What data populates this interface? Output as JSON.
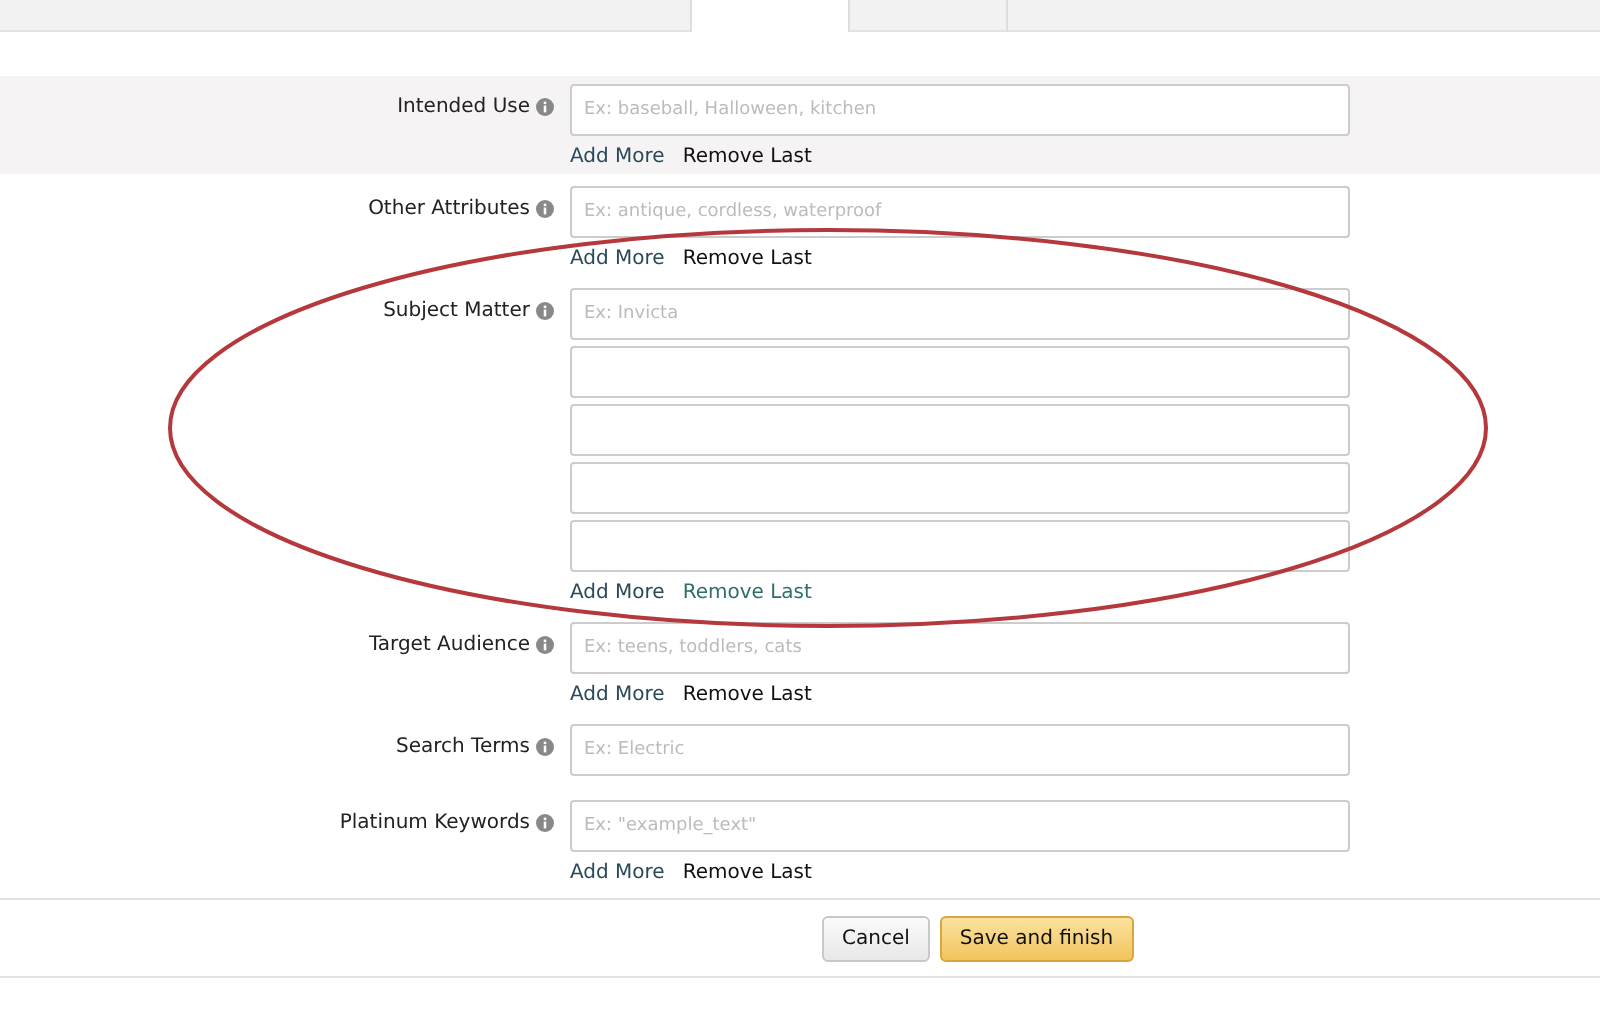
{
  "tabs": [
    {
      "selected": false
    },
    {
      "selected": true
    },
    {
      "selected": false
    }
  ],
  "fields": [
    {
      "label": "Intended Use",
      "highlighted": true,
      "inputs": [
        {
          "placeholder": "Ex: baseball, Halloween, kitchen"
        }
      ],
      "links": {
        "add": "Add More",
        "remove": "Remove Last",
        "remove_disabled": true
      }
    },
    {
      "label": "Other Attributes",
      "highlighted": false,
      "inputs": [
        {
          "placeholder": "Ex: antique, cordless, waterproof"
        }
      ],
      "links": {
        "add": "Add More",
        "remove": "Remove Last",
        "remove_disabled": true
      }
    },
    {
      "label": "Subject Matter",
      "highlighted": false,
      "inputs": [
        {
          "kind": "hint",
          "placeholder": "Ex: Invicta"
        },
        {
          "kind": "blank"
        },
        {
          "kind": "blank"
        },
        {
          "kind": "blank"
        },
        {
          "kind": "blank"
        }
      ],
      "links": {
        "add": "Add More",
        "remove": "Remove Last",
        "remove_disabled": false
      }
    },
    {
      "label": "Target Audience",
      "highlighted": false,
      "inputs": [
        {
          "placeholder": "Ex: teens, toddlers, cats"
        }
      ],
      "links": {
        "add": "Add More",
        "remove": "Remove Last",
        "remove_disabled": true
      }
    },
    {
      "label": "Search Terms",
      "highlighted": false,
      "inputs": [
        {
          "placeholder": "Ex: Electric"
        }
      ]
    },
    {
      "label": "Platinum Keywords",
      "highlighted": false,
      "inputs": [
        {
          "placeholder": "Ex: \"example_text\""
        }
      ],
      "links": {
        "add": "Add More",
        "remove": "Remove Last",
        "remove_disabled": true
      }
    }
  ],
  "annotation": {
    "kind": "ellipse"
  },
  "buttons": [
    {
      "kind": "secondary",
      "label": "Cancel"
    },
    {
      "kind": "primary",
      "label": "Save and finish"
    }
  ]
}
